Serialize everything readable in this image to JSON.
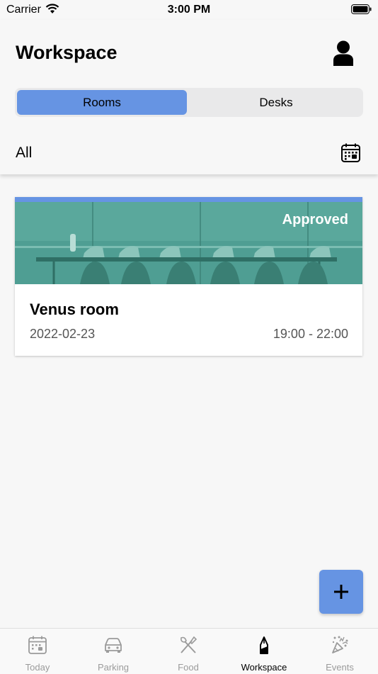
{
  "status_bar": {
    "carrier": "Carrier",
    "time": "3:00 PM"
  },
  "header": {
    "title": "Workspace",
    "segments": [
      {
        "label": "Rooms",
        "selected": true
      },
      {
        "label": "Desks",
        "selected": false
      }
    ],
    "filter_label": "All"
  },
  "bookings": [
    {
      "status": "Approved",
      "room": "Venus room",
      "date": "2022-02-23",
      "time": "19:00 - 22:00"
    }
  ],
  "tabbar": {
    "tabs": [
      {
        "label": "Today",
        "icon": "calendar-icon"
      },
      {
        "label": "Parking",
        "icon": "car-icon"
      },
      {
        "label": "Food",
        "icon": "fork-knife-icon"
      },
      {
        "label": "Workspace",
        "icon": "pen-icon",
        "selected": true
      },
      {
        "label": "Events",
        "icon": "confetti-icon"
      }
    ]
  },
  "colors": {
    "accent": "#6694e3",
    "image_overlay": "#3f9b8f",
    "tab_inactive": "#9b9b9b"
  }
}
